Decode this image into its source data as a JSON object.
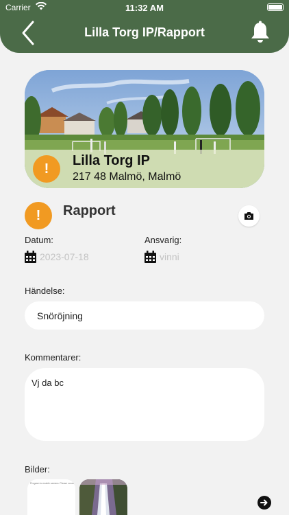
{
  "status_bar": {
    "carrier": "Carrier",
    "time": "11:32 AM"
  },
  "nav": {
    "title": "Lilla Torg IP/Rapport",
    "back_icon": "chevron-left-icon",
    "bell_icon": "bell-icon"
  },
  "location": {
    "name": "Lilla Torg IP",
    "address": "217 48 Malmö, Malmö",
    "alert_symbol": "!"
  },
  "report": {
    "title": "Rapport",
    "alert_symbol": "!"
  },
  "datum": {
    "label": "Datum:",
    "value": "2023-07-18"
  },
  "ansvarig": {
    "label": "Ansvarig:",
    "value": "vinni"
  },
  "handelse": {
    "label": "Händelse:",
    "value": "Snöröjning"
  },
  "kommentarer": {
    "label": "Kommentarer:",
    "value": "Vj da bc"
  },
  "bilder": {
    "label": "Bilder:",
    "thumb1_caption": "Program to enable camera. Please connect a ph"
  },
  "colors": {
    "header": "#4b6b48",
    "alert": "#f19a22",
    "background": "#f2f2f2"
  }
}
